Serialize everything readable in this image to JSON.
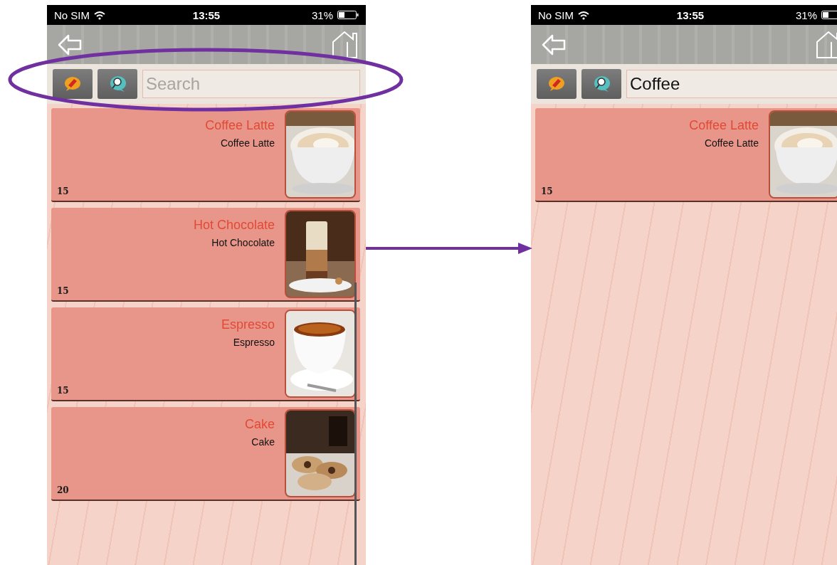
{
  "screens": [
    {
      "status_bar": {
        "carrier": "No SIM",
        "time": "13:55",
        "battery": "31%"
      },
      "search": {
        "placeholder": "Search"
      },
      "scrollbar_visible": true,
      "items": [
        {
          "title": "Coffee Latte",
          "subtitle": "Coffee Latte",
          "price": "15"
        },
        {
          "title": "Hot Chocolate",
          "subtitle": "Hot Chocolate",
          "price": "15"
        },
        {
          "title": "Espresso",
          "subtitle": "Espresso",
          "price": "15"
        },
        {
          "title": "Cake",
          "subtitle": "Cake",
          "price": "20"
        }
      ]
    },
    {
      "status_bar": {
        "carrier": "No SIM",
        "time": "13:55",
        "battery": "31%"
      },
      "search": {
        "value": "Coffee"
      },
      "scrollbar_visible": false,
      "items": [
        {
          "title": "Coffee Latte",
          "subtitle": "Coffee Latte",
          "price": "15"
        }
      ]
    }
  ]
}
